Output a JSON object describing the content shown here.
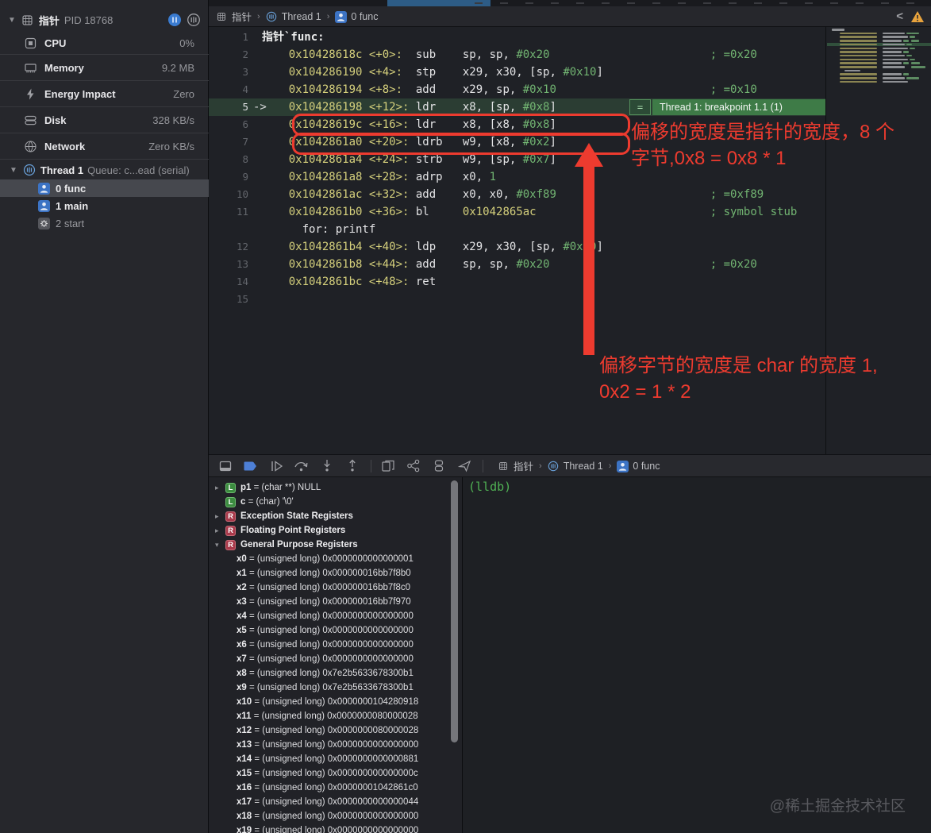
{
  "sidebar": {
    "process": {
      "name": "指针",
      "pid": "PID 18768"
    },
    "gauges": [
      {
        "icon": "cpu-icon",
        "label": "CPU",
        "value": "0%"
      },
      {
        "icon": "memory-icon",
        "label": "Memory",
        "value": "9.2 MB"
      },
      {
        "icon": "energy-icon",
        "label": "Energy Impact",
        "value": "Zero"
      },
      {
        "icon": "disk-icon",
        "label": "Disk",
        "value": "328 KB/s"
      },
      {
        "icon": "network-icon",
        "label": "Network",
        "value": "Zero KB/s"
      }
    ],
    "thread": {
      "name": "Thread 1",
      "queue": "Queue: c...ead (serial)"
    },
    "frames": [
      {
        "icon": "person-icon",
        "label": "0 func",
        "selected": true,
        "dim": false
      },
      {
        "icon": "person-icon",
        "label": "1 main",
        "selected": false,
        "dim": false
      },
      {
        "icon": "gear-icon",
        "label": "2 start",
        "selected": false,
        "dim": true
      }
    ]
  },
  "jump_bar": {
    "items": [
      {
        "icon": "app-chip-icon",
        "label": "指针"
      },
      {
        "icon": "thread-icon",
        "label": "Thread 1"
      },
      {
        "icon": "person-icon",
        "label": "0 func"
      }
    ]
  },
  "code": {
    "lines": [
      {
        "n": "1",
        "segs": [
          {
            "t": "指针`func:",
            "c": "label"
          }
        ]
      },
      {
        "n": "2",
        "segs": [
          {
            "t": "    0x10428618c <+0>:  ",
            "c": "y"
          },
          {
            "t": "sub    sp, sp, ",
            "c": "w"
          },
          {
            "t": "#0x20",
            "c": "g"
          },
          {
            "t": "                        ",
            "c": "w"
          },
          {
            "t": "; =0x20",
            "c": "g"
          }
        ]
      },
      {
        "n": "3",
        "segs": [
          {
            "t": "    0x104286190 <+4>:  ",
            "c": "y"
          },
          {
            "t": "stp    x29, x30, [sp, ",
            "c": "w"
          },
          {
            "t": "#0x10",
            "c": "g"
          },
          {
            "t": "]",
            "c": "w"
          }
        ]
      },
      {
        "n": "4",
        "segs": [
          {
            "t": "    0x104286194 <+8>:  ",
            "c": "y"
          },
          {
            "t": "add    x29, sp, ",
            "c": "w"
          },
          {
            "t": "#0x10",
            "c": "g"
          },
          {
            "t": "                       ",
            "c": "w"
          },
          {
            "t": "; =0x10",
            "c": "g"
          }
        ]
      },
      {
        "n": "5",
        "bp": true,
        "segs": [
          {
            "t": "    0x104286198 <+12>: ",
            "c": "y"
          },
          {
            "t": "ldr    x8, [sp, ",
            "c": "w"
          },
          {
            "t": "#0x8",
            "c": "g"
          },
          {
            "t": "]",
            "c": "w"
          }
        ]
      },
      {
        "n": "6",
        "segs": [
          {
            "t": "    0x10428619c <+16>: ",
            "c": "y"
          },
          {
            "t": "ldr    x8, [x8, ",
            "c": "w"
          },
          {
            "t": "#0x8",
            "c": "g"
          },
          {
            "t": "]",
            "c": "w"
          }
        ]
      },
      {
        "n": "7",
        "segs": [
          {
            "t": "    0x1042861a0 <+20>: ",
            "c": "y"
          },
          {
            "t": "ldrb   w9, [x8, ",
            "c": "w"
          },
          {
            "t": "#0x2",
            "c": "g"
          },
          {
            "t": "]",
            "c": "w"
          }
        ]
      },
      {
        "n": "8",
        "segs": [
          {
            "t": "    0x1042861a4 <+24>: ",
            "c": "y"
          },
          {
            "t": "strb   w9, [sp, ",
            "c": "w"
          },
          {
            "t": "#0x7",
            "c": "g"
          },
          {
            "t": "]",
            "c": "w"
          }
        ]
      },
      {
        "n": "9",
        "segs": [
          {
            "t": "    0x1042861a8 <+28>: ",
            "c": "y"
          },
          {
            "t": "adrp   x0, ",
            "c": "w"
          },
          {
            "t": "1",
            "c": "g"
          }
        ]
      },
      {
        "n": "10",
        "segs": [
          {
            "t": "    0x1042861ac <+32>: ",
            "c": "y"
          },
          {
            "t": "add    x0, x0, ",
            "c": "w"
          },
          {
            "t": "#0xf89",
            "c": "g"
          },
          {
            "t": "                       ",
            "c": "w"
          },
          {
            "t": "; =0xf89",
            "c": "g"
          }
        ]
      },
      {
        "n": "11",
        "segs": [
          {
            "t": "    0x1042861b0 <+36>: ",
            "c": "y"
          },
          {
            "t": "bl     ",
            "c": "w"
          },
          {
            "t": "0x1042865ac",
            "c": "y"
          },
          {
            "t": "                          ",
            "c": "w"
          },
          {
            "t": "; symbol stub",
            "c": "g"
          }
        ]
      },
      {
        "n": "",
        "segs": [
          {
            "t": "      for: printf",
            "c": "w"
          }
        ]
      },
      {
        "n": "12",
        "segs": [
          {
            "t": "    0x1042861b4 <+40>: ",
            "c": "y"
          },
          {
            "t": "ldp    x29, x30, [sp, ",
            "c": "w"
          },
          {
            "t": "#0x10",
            "c": "g"
          },
          {
            "t": "]",
            "c": "w"
          }
        ]
      },
      {
        "n": "13",
        "segs": [
          {
            "t": "    0x1042861b8 <+44>: ",
            "c": "y"
          },
          {
            "t": "add    sp, sp, ",
            "c": "w"
          },
          {
            "t": "#0x20",
            "c": "g"
          },
          {
            "t": "                        ",
            "c": "w"
          },
          {
            "t": "; =0x20",
            "c": "g"
          }
        ]
      },
      {
        "n": "14",
        "segs": [
          {
            "t": "    0x1042861bc <+48>: ",
            "c": "y"
          },
          {
            "t": "ret",
            "c": "w"
          }
        ]
      },
      {
        "n": "15",
        "segs": []
      }
    ]
  },
  "breakpoint": {
    "equals": "=",
    "label": "Thread 1: breakpoint 1.1 (1)"
  },
  "annotations": {
    "note1": "偏移的宽度是指针的宽度，8 个\n字节,0x8 = 0x8 * 1",
    "note2": "偏移字节的宽度是 char 的宽度 1,\n0x2 = 1 * 2"
  },
  "debug_bar": {
    "icons": [
      "hide-debug-area-icon",
      "breakpoints-toggle-icon",
      "continue-icon",
      "step-over-icon",
      "step-into-icon",
      "step-out-icon",
      "view-hierarchy-icon",
      "memory-graph-icon",
      "stack-frames-icon",
      "simulate-location-icon"
    ]
  },
  "variables": {
    "locals": [
      {
        "disclosure": ">",
        "badge": "L",
        "name": "p1",
        "rest": "= (char **) NULL"
      },
      {
        "disclosure": "",
        "badge": "L",
        "name": "c",
        "rest": "= (char) '\\0'"
      }
    ],
    "groups": [
      {
        "disclosure": ">",
        "badge": "R",
        "label": "Exception State Registers"
      },
      {
        "disclosure": ">",
        "badge": "R",
        "label": "Floating Point Registers"
      },
      {
        "disclosure": "v",
        "badge": "R",
        "label": "General Purpose Registers"
      }
    ],
    "registers": [
      {
        "name": "x0",
        "rest": "= (unsigned long) 0x0000000000000001"
      },
      {
        "name": "x1",
        "rest": "= (unsigned long) 0x000000016bb7f8b0"
      },
      {
        "name": "x2",
        "rest": "= (unsigned long) 0x000000016bb7f8c0"
      },
      {
        "name": "x3",
        "rest": "= (unsigned long) 0x000000016bb7f970"
      },
      {
        "name": "x4",
        "rest": "= (unsigned long) 0x0000000000000000"
      },
      {
        "name": "x5",
        "rest": "= (unsigned long) 0x0000000000000000"
      },
      {
        "name": "x6",
        "rest": "= (unsigned long) 0x0000000000000000"
      },
      {
        "name": "x7",
        "rest": "= (unsigned long) 0x0000000000000000"
      },
      {
        "name": "x8",
        "rest": "= (unsigned long) 0x7e2b5633678300b1"
      },
      {
        "name": "x9",
        "rest": "= (unsigned long) 0x7e2b5633678300b1"
      },
      {
        "name": "x10",
        "rest": "= (unsigned long) 0x0000000104280918"
      },
      {
        "name": "x11",
        "rest": "= (unsigned long) 0x0000000080000028"
      },
      {
        "name": "x12",
        "rest": "= (unsigned long) 0x0000000080000028"
      },
      {
        "name": "x13",
        "rest": "= (unsigned long) 0x0000000000000000"
      },
      {
        "name": "x14",
        "rest": "= (unsigned long) 0x0000000000000881"
      },
      {
        "name": "x15",
        "rest": "= (unsigned long) 0x000000000000000c"
      },
      {
        "name": "x16",
        "rest": "= (unsigned long) 0x00000001042861c0"
      },
      {
        "name": "x17",
        "rest": "= (unsigned long) 0x0000000000000044"
      },
      {
        "name": "x18",
        "rest": "= (unsigned long) 0x0000000000000000"
      },
      {
        "name": "x19",
        "rest": "= (unsigned long) 0x0000000000000000"
      }
    ]
  },
  "console": {
    "prompt": "(lldb)"
  },
  "watermark": "@稀土掘金技术社区",
  "colors": {
    "accent_red": "#ed3b2f",
    "breakpoint_green": "#3e7b47",
    "address_yellow": "#d5d07c",
    "immediate_green": "#72b572",
    "breakpoint_blue": "#4d7fd6"
  }
}
